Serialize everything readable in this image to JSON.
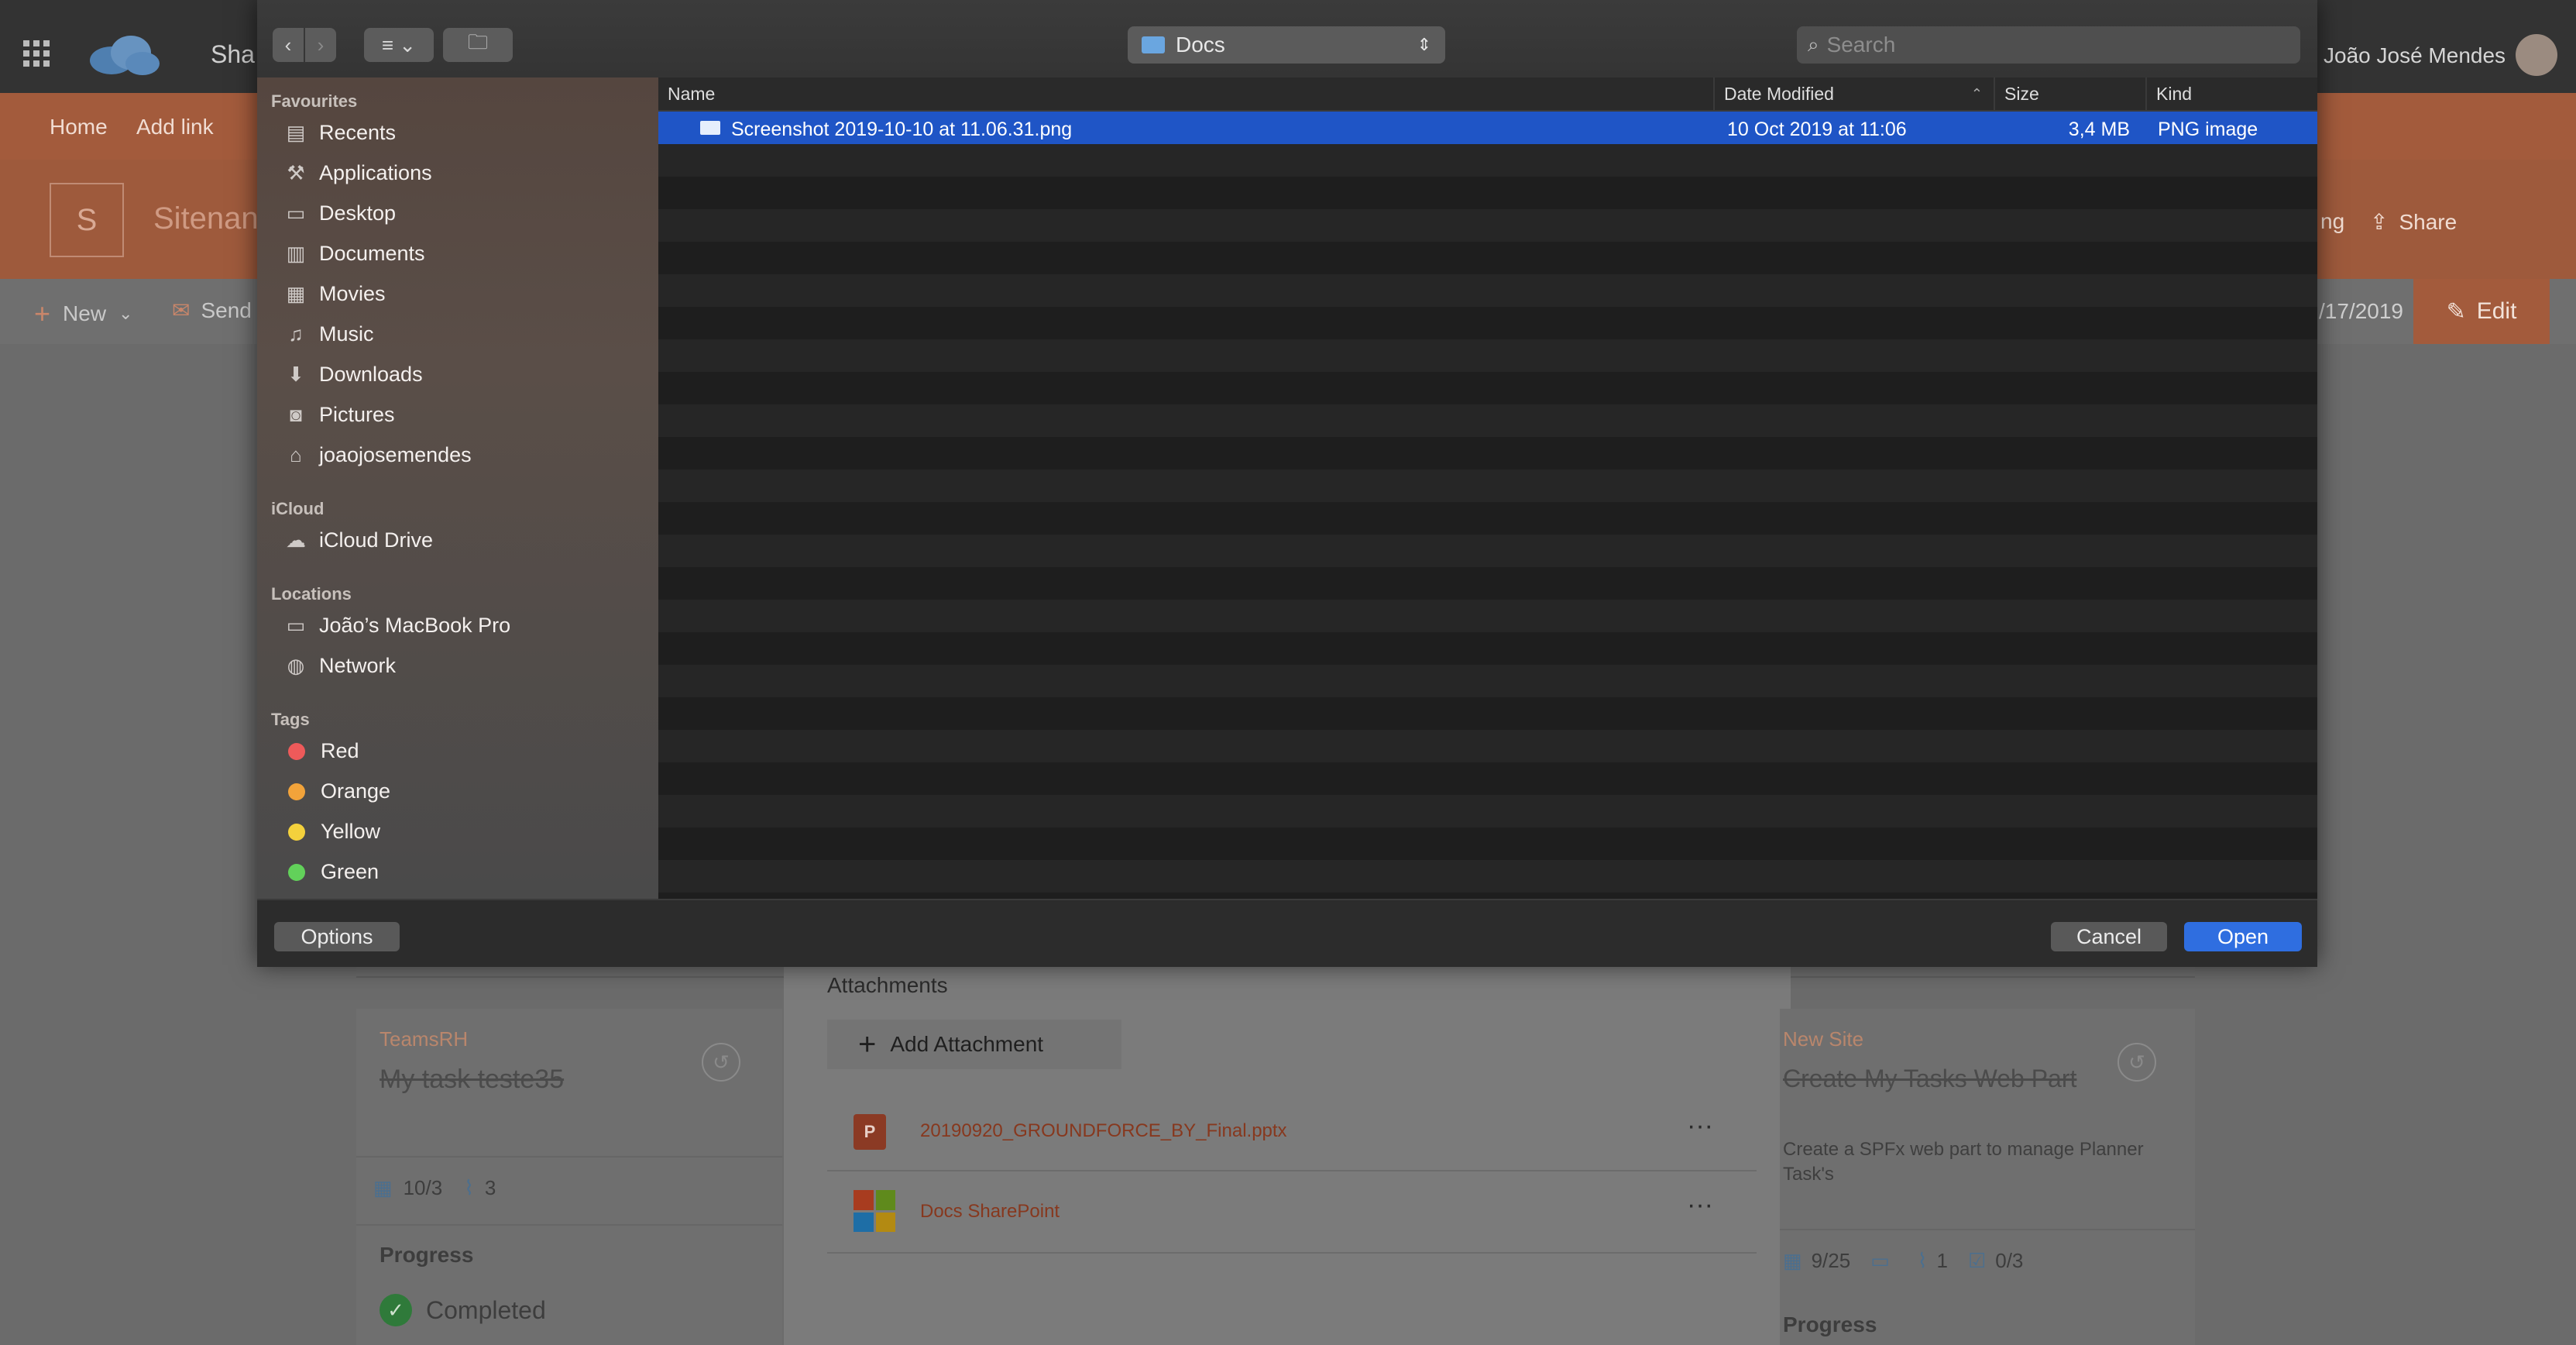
{
  "colors": {
    "accent_blue": "#1f55c6",
    "sharepoint_orange": "#a35b3c",
    "tag_red": "#ee5a5a",
    "tag_orange": "#f2a33a",
    "tag_yellow": "#f4d13c",
    "tag_green": "#62d15a"
  },
  "background_page": {
    "app_title": "Sha",
    "user_name": "João José Mendes",
    "nav": [
      "Home",
      "Add link"
    ],
    "site_logo_letter": "S",
    "site_name": "Sitenan",
    "header_actions": {
      "following_partial": "ng",
      "share": "Share"
    },
    "command_bar": {
      "new": "New",
      "send": "Send",
      "date_partial": "/17/2019",
      "edit": "Edit"
    },
    "left_card": {
      "group": "TeamsRH",
      "title": "My task teste35",
      "date": "10/3",
      "attachments": "3",
      "progress_label": "Progress",
      "progress_value": "Completed"
    },
    "middle_panel": {
      "attachments_label": "Attachments",
      "add_attachment": "Add Attachment",
      "files": [
        {
          "name": "20190920_GROUNDFORCE_BY_Final.pptx",
          "icon": "powerpoint-icon",
          "more": "···"
        },
        {
          "name": "Docs SharePoint",
          "icon": "microsoft-icon",
          "more": "···"
        }
      ]
    },
    "right_card": {
      "group": "New Site",
      "title": "Create My Tasks Web Part",
      "description": "Create a SPFx web part to manage Planner Task's",
      "date": "9/25",
      "attachments": "1",
      "checklist": "0/3",
      "progress_label": "Progress"
    }
  },
  "dialog": {
    "location": "Docs",
    "search_placeholder": "Search",
    "sidebar": {
      "favourites_label": "Favourites",
      "favourites": [
        {
          "label": "Recents",
          "icon": "recents-icon"
        },
        {
          "label": "Applications",
          "icon": "applications-icon"
        },
        {
          "label": "Desktop",
          "icon": "desktop-icon"
        },
        {
          "label": "Documents",
          "icon": "documents-icon"
        },
        {
          "label": "Movies",
          "icon": "movies-icon"
        },
        {
          "label": "Music",
          "icon": "music-icon"
        },
        {
          "label": "Downloads",
          "icon": "downloads-icon"
        },
        {
          "label": "Pictures",
          "icon": "pictures-icon"
        },
        {
          "label": "joaojosemendes",
          "icon": "home-icon"
        }
      ],
      "icloud_label": "iCloud",
      "icloud": [
        {
          "label": "iCloud Drive",
          "icon": "cloud-icon"
        }
      ],
      "locations_label": "Locations",
      "locations": [
        {
          "label": "João’s MacBook Pro",
          "icon": "laptop-icon"
        },
        {
          "label": "Network",
          "icon": "network-icon"
        }
      ],
      "tags_label": "Tags",
      "tags": [
        "Red",
        "Orange",
        "Yellow",
        "Green"
      ]
    },
    "columns": {
      "name": "Name",
      "date": "Date Modified",
      "size": "Size",
      "kind": "Kind"
    },
    "files": [
      {
        "name": "Screenshot 2019-10-10 at 11.06.31.png",
        "date": "10 Oct 2019 at 11:06",
        "size": "3,4 MB",
        "kind": "PNG image"
      }
    ],
    "buttons": {
      "options": "Options",
      "cancel": "Cancel",
      "open": "Open"
    }
  }
}
